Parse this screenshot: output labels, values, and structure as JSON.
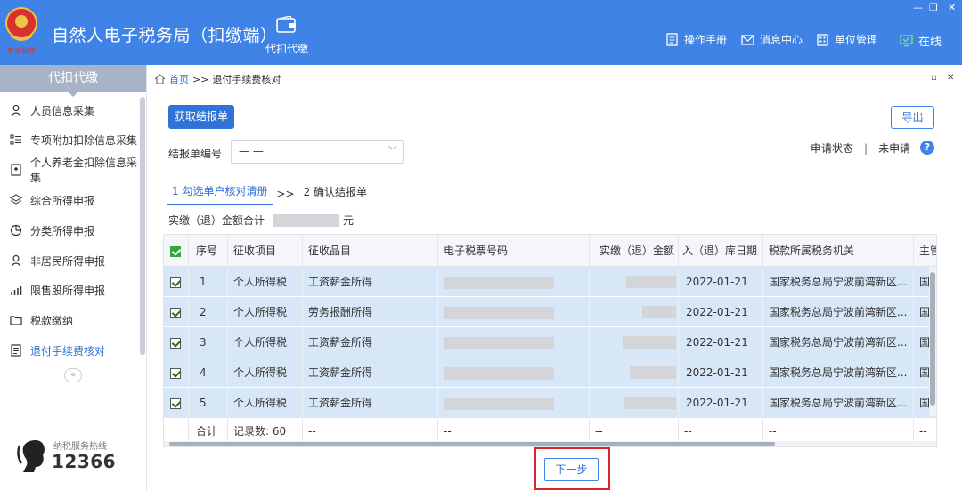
{
  "header": {
    "app_title": "自然人电子税务局（扣缴端）",
    "module_label": "代扣代缴",
    "links": [
      {
        "label": "操作手册",
        "icon": "manual-icon"
      },
      {
        "label": "消息中心",
        "icon": "message-icon"
      },
      {
        "label": "单位管理",
        "icon": "building-icon"
      },
      {
        "label": "在线",
        "icon": "monitor-icon"
      }
    ],
    "emblem_text": "宁波税务"
  },
  "sidebar": {
    "title": "代扣代缴",
    "items": [
      {
        "label": "人员信息采集",
        "icon": "person-icon"
      },
      {
        "label": "专项附加扣除信息采集",
        "icon": "list-icon"
      },
      {
        "label": "个人养老金扣除信息采集",
        "icon": "id-card-icon"
      },
      {
        "label": "综合所得申报",
        "icon": "layers-icon"
      },
      {
        "label": "分类所得申报",
        "icon": "pie-icon"
      },
      {
        "label": "非居民所得申报",
        "icon": "person-icon"
      },
      {
        "label": "限售股所得申报",
        "icon": "bar-chart-icon"
      },
      {
        "label": "税款缴纳",
        "icon": "folder-icon"
      },
      {
        "label": "退付手续费核对",
        "icon": "document-icon",
        "active": true
      }
    ],
    "collapse_glyph": "«",
    "hotline_label": "纳税服务热线",
    "hotline_number": "12366"
  },
  "breadcrumb": {
    "home": "首页",
    "sep": ">>",
    "current": "退付手续费核对"
  },
  "toolbar": {
    "fetch_label": "获取结报单",
    "export_label": "导出"
  },
  "form": {
    "report_no_label": "结报单编号",
    "report_no_value": "— —",
    "status_label": "申请状态",
    "status_sep": "|",
    "status_value": "未申请",
    "help_glyph": "?"
  },
  "steps": {
    "step1": "1 勾选单户核对清册",
    "sep": ">>",
    "step2": "2 确认结报单"
  },
  "amount": {
    "label": "实缴（退）金额合计",
    "unit": "元"
  },
  "table": {
    "headers": [
      "序号",
      "征收项目",
      "征收品目",
      "电子税票号码",
      "实缴（退）金额",
      "入（退）库日期",
      "税款所属税务机关",
      "主管"
    ],
    "rows": [
      {
        "no": "1",
        "item": "个人所得税",
        "subitem": "工资薪金所得",
        "date": "2022-01-21",
        "office": "国家税务总局宁波前湾新区...",
        "cut": "国",
        "checked": true
      },
      {
        "no": "2",
        "item": "个人所得税",
        "subitem": "劳务报酬所得",
        "date": "2022-01-21",
        "office": "国家税务总局宁波前湾新区...",
        "cut": "国",
        "checked": true
      },
      {
        "no": "3",
        "item": "个人所得税",
        "subitem": "工资薪金所得",
        "date": "2022-01-21",
        "office": "国家税务总局宁波前湾新区...",
        "cut": "国",
        "checked": true
      },
      {
        "no": "4",
        "item": "个人所得税",
        "subitem": "工资薪金所得",
        "date": "2022-01-21",
        "office": "国家税务总局宁波前湾新区...",
        "cut": "国",
        "checked": true
      },
      {
        "no": "5",
        "item": "个人所得税",
        "subitem": "工资薪金所得",
        "date": "2022-01-21",
        "office": "国家税务总局宁波前湾新区...",
        "cut": "国",
        "checked": true
      }
    ],
    "footer": {
      "total_label": "合计",
      "count_label": "记录数: 60",
      "dash": "--"
    }
  },
  "next_label": "下一步",
  "colors": {
    "topbar": "#3f83e6",
    "primary": "#2f73d6",
    "row_selected": "#d7e7f7",
    "highlight": "#d9262b"
  }
}
